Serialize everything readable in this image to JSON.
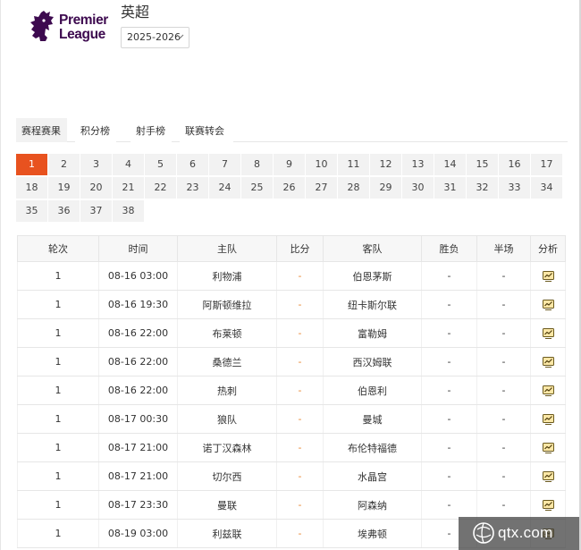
{
  "brand": {
    "line1": "Premier",
    "line2": "League",
    "color": "#3d0a4f"
  },
  "league": {
    "name": "英超",
    "season": "2025-2026"
  },
  "tabs": [
    {
      "label": "赛程赛果",
      "active": true
    },
    {
      "label": "积分榜",
      "active": false
    },
    {
      "label": "射手榜",
      "active": false
    },
    {
      "label": "联赛转会",
      "active": false
    }
  ],
  "rounds": {
    "items": [
      "1",
      "2",
      "3",
      "4",
      "5",
      "6",
      "7",
      "8",
      "9",
      "10",
      "11",
      "12",
      "13",
      "14",
      "15",
      "16",
      "17",
      "18",
      "19",
      "20",
      "21",
      "22",
      "23",
      "24",
      "25",
      "26",
      "27",
      "28",
      "29",
      "30",
      "31",
      "32",
      "33",
      "34",
      "35",
      "36",
      "37",
      "38"
    ],
    "selected": "1",
    "accent": "#e8521f"
  },
  "table": {
    "headers": [
      "轮次",
      "时间",
      "主队",
      "比分",
      "客队",
      "胜负",
      "半场",
      "分析"
    ],
    "rows": [
      {
        "round": "1",
        "time": "08-16 03:00",
        "home": "利物浦",
        "score": "-",
        "away": "伯恩茅斯",
        "result": "-",
        "half": "-"
      },
      {
        "round": "1",
        "time": "08-16 19:30",
        "home": "阿斯顿维拉",
        "score": "-",
        "away": "纽卡斯尔联",
        "result": "-",
        "half": "-"
      },
      {
        "round": "1",
        "time": "08-16 22:00",
        "home": "布莱顿",
        "score": "-",
        "away": "富勒姆",
        "result": "-",
        "half": "-"
      },
      {
        "round": "1",
        "time": "08-16 22:00",
        "home": "桑德兰",
        "score": "-",
        "away": "西汉姆联",
        "result": "-",
        "half": "-"
      },
      {
        "round": "1",
        "time": "08-16 22:00",
        "home": "热刺",
        "score": "-",
        "away": "伯恩利",
        "result": "-",
        "half": "-"
      },
      {
        "round": "1",
        "time": "08-17 00:30",
        "home": "狼队",
        "score": "-",
        "away": "曼城",
        "result": "-",
        "half": "-"
      },
      {
        "round": "1",
        "time": "08-17 21:00",
        "home": "诺丁汉森林",
        "score": "-",
        "away": "布伦特福德",
        "result": "-",
        "half": "-"
      },
      {
        "round": "1",
        "time": "08-17 21:00",
        "home": "切尔西",
        "score": "-",
        "away": "水晶宫",
        "result": "-",
        "half": "-"
      },
      {
        "round": "1",
        "time": "08-17 23:30",
        "home": "曼联",
        "score": "-",
        "away": "阿森纳",
        "result": "-",
        "half": "-"
      },
      {
        "round": "1",
        "time": "08-19 03:00",
        "home": "利兹联",
        "score": "-",
        "away": "埃弗顿",
        "result": "-",
        "half": "-"
      }
    ],
    "analysis_icon": "analysis-chart-icon",
    "score_color": "#e8862f"
  },
  "watermark": {
    "text": "qtx.com"
  }
}
